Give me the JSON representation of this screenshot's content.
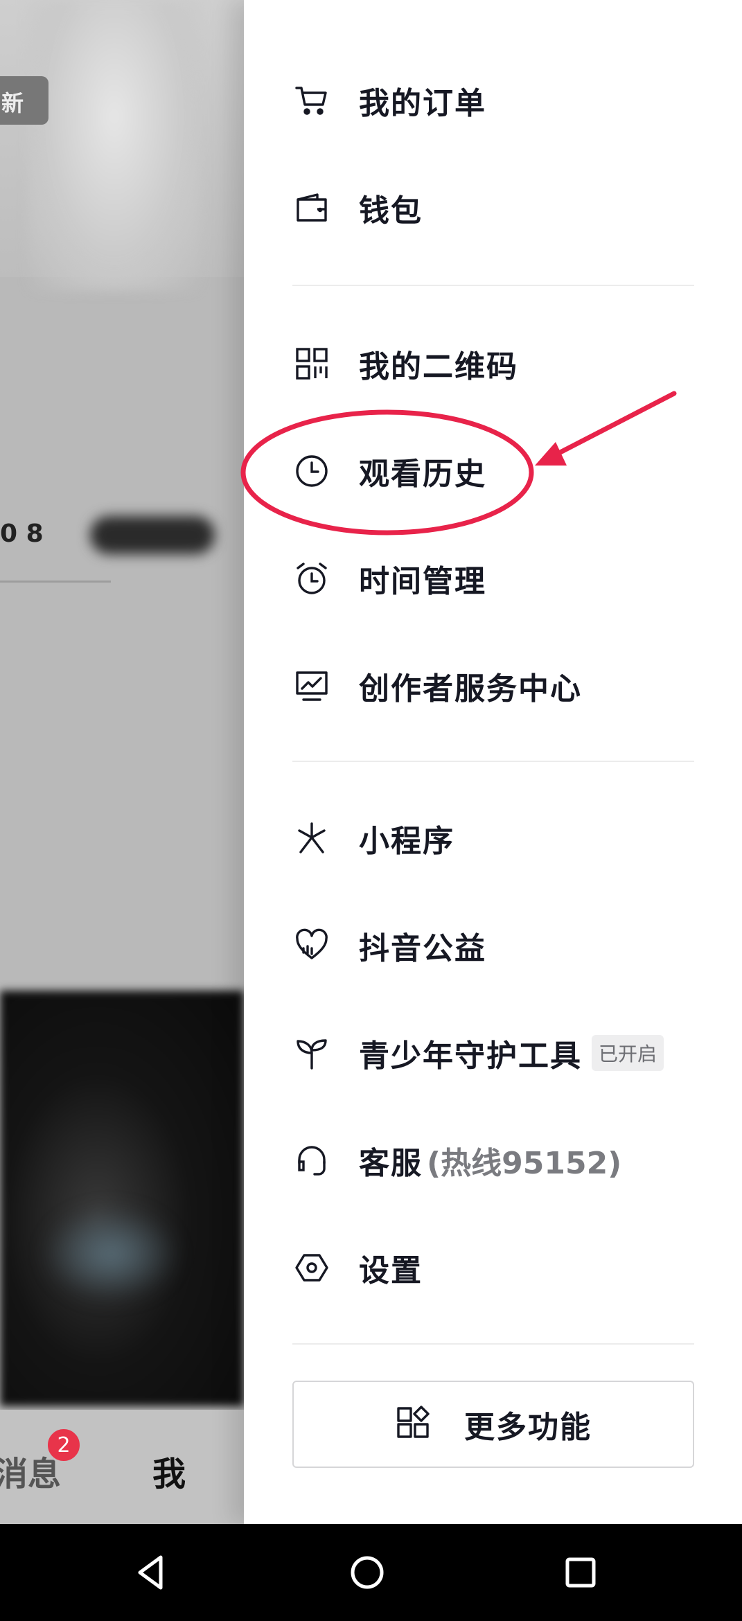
{
  "background": {
    "tag_text": "新",
    "left_fragment": "0 8",
    "tabs": {
      "messages_label": "消息",
      "messages_badge": "2",
      "me_label": "我"
    }
  },
  "drawer": {
    "items": [
      {
        "label": "我的订单",
        "icon": "cart-icon"
      },
      {
        "label": "钱包",
        "icon": "wallet-icon"
      },
      {
        "label": "我的二维码",
        "icon": "qr-code-icon"
      },
      {
        "label": "观看历史",
        "icon": "clock-icon"
      },
      {
        "label": "时间管理",
        "icon": "alarm-clock-icon"
      },
      {
        "label": "创作者服务中心",
        "icon": "monitor-chart-icon"
      },
      {
        "label": "小程序",
        "icon": "mini-program-icon"
      },
      {
        "label": "抖音公益",
        "icon": "charity-heart-icon"
      },
      {
        "label": "青少年守护工具",
        "icon": "sprout-icon",
        "badge": "已开启"
      },
      {
        "label": "客服",
        "sub": "(热线95152)",
        "icon": "headset-icon"
      },
      {
        "label": "设置",
        "icon": "settings-hexagon-icon"
      }
    ],
    "more_button": {
      "label": "更多功能",
      "icon": "apps-grid-icon"
    }
  },
  "annotation": {
    "color": "#e8234a"
  },
  "system_nav": {
    "back": "back-icon",
    "home": "home-icon",
    "recents": "recents-icon"
  }
}
